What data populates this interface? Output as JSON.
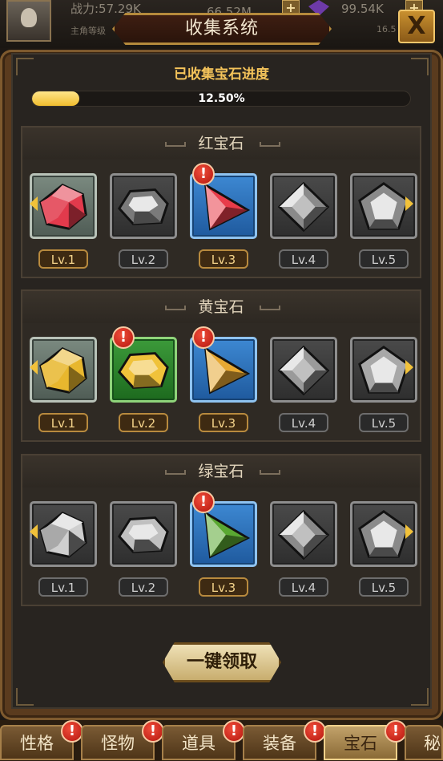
{
  "topbar": {
    "power_text": "战力:57.29K",
    "resource1": "66.52M",
    "resource2": "99.54K",
    "sub_label": "主角等级",
    "sub_value": "16.5"
  },
  "window": {
    "title": "收集系统",
    "close_label": "X"
  },
  "progress": {
    "label": "已收集宝石进度",
    "percent_text": "12.50%",
    "fraction": 0.125
  },
  "sections": [
    {
      "title": "红宝石",
      "gems": [
        {
          "level": "Lv.1",
          "state": "owned",
          "shape": "hex",
          "color": "#e23a4c",
          "alert": false
        },
        {
          "level": "Lv.2",
          "state": "gray",
          "shape": "oval",
          "color": "#7a7a7a",
          "alert": false
        },
        {
          "level": "Lv.3",
          "state": "blue",
          "shape": "tri",
          "color": "#e83c4a",
          "alert": true
        },
        {
          "level": "Lv.4",
          "state": "gray",
          "shape": "diamond",
          "color": "#8a8a8a",
          "alert": false
        },
        {
          "level": "Lv.5",
          "state": "gray",
          "shape": "pent",
          "color": "#8a8a8a",
          "alert": false
        }
      ]
    },
    {
      "title": "黄宝石",
      "gems": [
        {
          "level": "Lv.1",
          "state": "owned",
          "shape": "hex",
          "color": "#e8b72e",
          "alert": false
        },
        {
          "level": "Lv.2",
          "state": "green",
          "shape": "oval",
          "color": "#f0c23a",
          "alert": true
        },
        {
          "level": "Lv.3",
          "state": "blue",
          "shape": "tri",
          "color": "#e6a832",
          "alert": true
        },
        {
          "level": "Lv.4",
          "state": "gray",
          "shape": "diamond",
          "color": "#9a9a9a",
          "alert": false
        },
        {
          "level": "Lv.5",
          "state": "gray",
          "shape": "pent",
          "color": "#a8a8a8",
          "alert": false
        }
      ]
    },
    {
      "title": "绿宝石",
      "gems": [
        {
          "level": "Lv.1",
          "state": "gray",
          "shape": "hex",
          "color": "#cfcfcf",
          "alert": false
        },
        {
          "level": "Lv.2",
          "state": "gray",
          "shape": "oval",
          "color": "#c0c0c0",
          "alert": false
        },
        {
          "level": "Lv.3",
          "state": "blue",
          "shape": "tri",
          "color": "#5aa832",
          "alert": true
        },
        {
          "level": "Lv.4",
          "state": "gray",
          "shape": "diamond",
          "color": "#8a8a8a",
          "alert": false
        },
        {
          "level": "Lv.5",
          "state": "gray",
          "shape": "pent",
          "color": "#8a8a8a",
          "alert": false
        }
      ]
    }
  ],
  "claim_button": "一键领取",
  "alert_glyph": "!",
  "bottom_tabs": [
    {
      "label": "性格",
      "alert": true,
      "active": false
    },
    {
      "label": "怪物",
      "alert": true,
      "active": false
    },
    {
      "label": "道具",
      "alert": true,
      "active": false
    },
    {
      "label": "装备",
      "alert": true,
      "active": false
    },
    {
      "label": "宝石",
      "alert": true,
      "active": true
    },
    {
      "label": "秘",
      "alert": false,
      "active": false
    }
  ]
}
